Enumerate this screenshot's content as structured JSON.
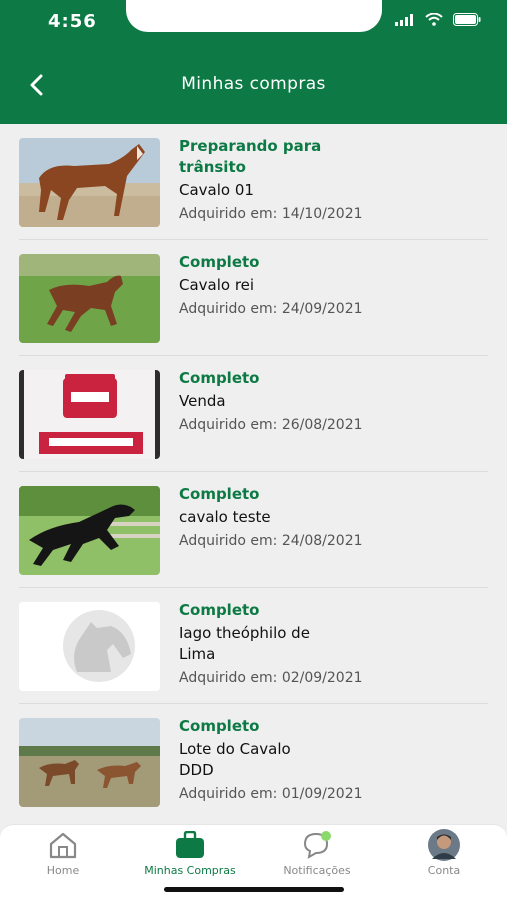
{
  "status_bar": {
    "time": "4:56"
  },
  "header": {
    "title": "Minhas compras"
  },
  "purchases": [
    {
      "status": "Preparando para trânsito",
      "name": "Cavalo 01",
      "date": "Adquirido em: 14/10/2021"
    },
    {
      "status": "Completo",
      "name": "Cavalo rei",
      "date": "Adquirido em: 24/09/2021"
    },
    {
      "status": "Completo",
      "name": "Venda",
      "date": "Adquirido em: 26/08/2021"
    },
    {
      "status": "Completo",
      "name": "cavalo teste",
      "date": "Adquirido em: 24/08/2021"
    },
    {
      "status": "Completo",
      "name": "Iago theóphilo de Lima",
      "date": "Adquirido em: 02/09/2021"
    },
    {
      "status": "Completo",
      "name": "Lote do Cavalo DDD",
      "date": "Adquirido em: 01/09/2021"
    }
  ],
  "tabs": [
    {
      "label": "Home",
      "icon": "home-icon"
    },
    {
      "label": "Minhas Compras",
      "icon": "bag-icon"
    },
    {
      "label": "Notificações",
      "icon": "chat-icon"
    },
    {
      "label": "Conta",
      "icon": "avatar"
    }
  ],
  "colors": {
    "brand": "#0d7a45",
    "background": "#efefef"
  }
}
